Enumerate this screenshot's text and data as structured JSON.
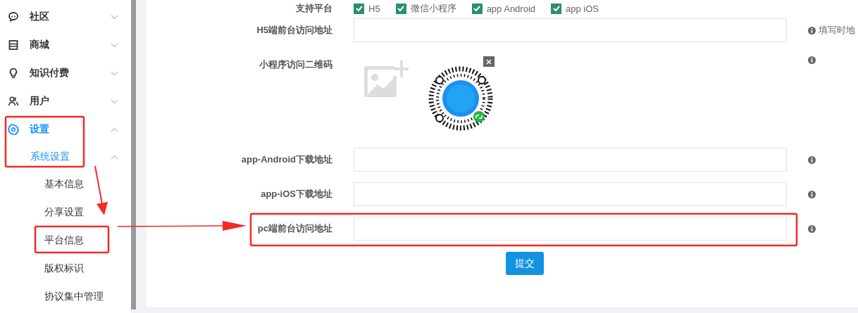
{
  "sidebar": {
    "items": [
      {
        "label": "社区",
        "expanded": false,
        "selected": false
      },
      {
        "label": "商城",
        "expanded": false,
        "selected": false
      },
      {
        "label": "知识付费",
        "expanded": false,
        "selected": false
      },
      {
        "label": "用户",
        "expanded": false,
        "selected": false
      },
      {
        "label": "设置",
        "expanded": true,
        "selected": true,
        "children": [
          {
            "label": "系统设置",
            "expanded": true,
            "selected": true,
            "children": [
              {
                "label": "基本信息",
                "selected": false
              },
              {
                "label": "分享设置",
                "selected": false
              },
              {
                "label": "平台信息",
                "selected": false
              },
              {
                "label": "版权标识",
                "selected": false
              },
              {
                "label": "协议集中管理",
                "selected": false
              }
            ]
          }
        ]
      }
    ]
  },
  "form": {
    "platforms": {
      "label": "支持平台",
      "options": [
        {
          "label": "H5",
          "checked": true
        },
        {
          "label": "微信小程序",
          "checked": true
        },
        {
          "label": "app Android",
          "checked": true
        },
        {
          "label": "app iOS",
          "checked": true
        }
      ]
    },
    "fields": [
      {
        "kind": "text",
        "label": "H5端前台访问地址",
        "hint": "填写时地"
      },
      {
        "kind": "image",
        "label": "小程序访问二维码"
      },
      {
        "kind": "text",
        "label": "app-Android下载地址"
      },
      {
        "kind": "text",
        "label": "app-iOS下载地址"
      },
      {
        "kind": "text",
        "label": "pc端前台访问地址"
      }
    ],
    "submit": "提交"
  }
}
